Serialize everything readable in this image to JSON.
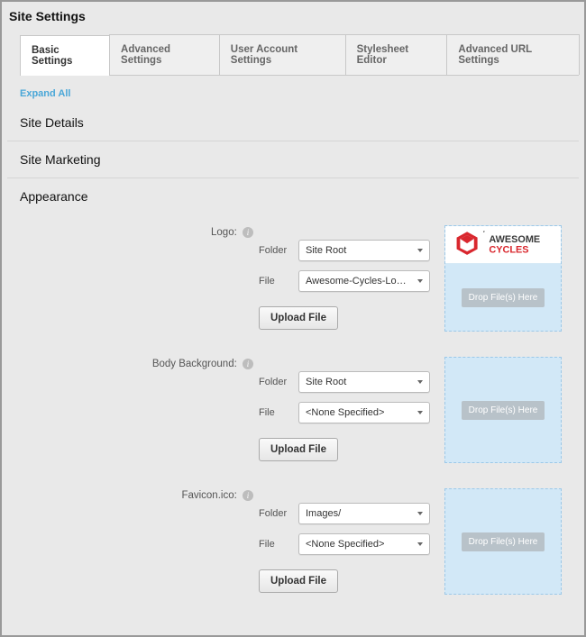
{
  "title": "Site Settings",
  "tabs": {
    "basic": "Basic Settings",
    "advanced": "Advanced Settings",
    "user": "User Account Settings",
    "stylesheet": "Stylesheet Editor",
    "url": "Advanced URL Settings"
  },
  "expand_all": "Expand All",
  "sections": {
    "details": "Site Details",
    "marketing": "Site Marketing",
    "appearance": "Appearance"
  },
  "labels": {
    "logo": "Logo:",
    "body_bg": "Body Background:",
    "favicon": "Favicon.ico:",
    "folder": "Folder",
    "file": "File",
    "upload": "Upload File",
    "drop": "Drop File(s) Here"
  },
  "appearance": {
    "logo": {
      "folder": "Site Root",
      "file": "Awesome-Cycles-Logo.png",
      "brand_word1": "AWESOME",
      "brand_word2": "CYCLES"
    },
    "body_bg": {
      "folder": "Site Root",
      "file": "<None Specified>"
    },
    "favicon": {
      "folder": "Images/",
      "file": "<None Specified>"
    }
  }
}
